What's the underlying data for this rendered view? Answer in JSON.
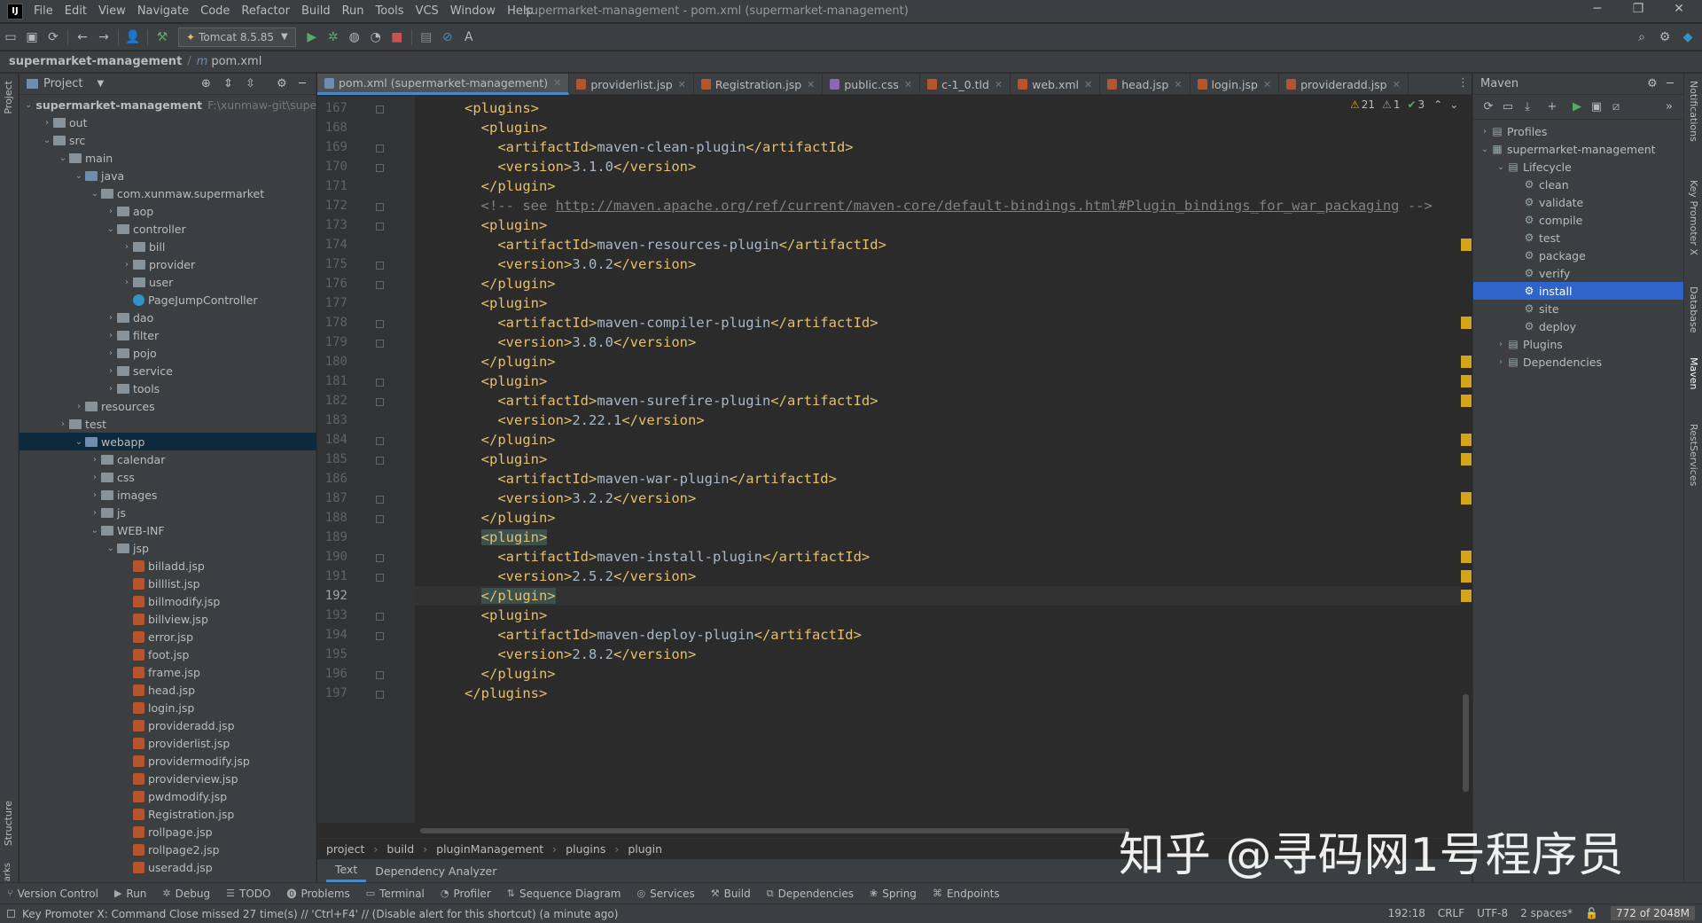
{
  "menu": [
    "File",
    "Edit",
    "View",
    "Navigate",
    "Code",
    "Refactor",
    "Build",
    "Run",
    "Tools",
    "VCS",
    "Window",
    "Help"
  ],
  "window_title": "supermarket-management - pom.xml (supermarket-management)",
  "run_config": "Tomcat 8.5.85",
  "breadcrumb": {
    "project": "supermarket-management",
    "file": "pom.xml"
  },
  "left_stripe": {
    "project": "Project",
    "structure": "Structure",
    "bookmarks": "Bookmarks"
  },
  "right_stripe": {
    "notifications": "Notifications",
    "key_promoter": "Key Promoter X",
    "database": "Database",
    "maven": "Maven",
    "rest": "RestServices"
  },
  "project_panel": {
    "title": "Project"
  },
  "tree": [
    {
      "label": "supermarket-management",
      "hint": "F:\\xunmaw-git\\superr",
      "depth": 0,
      "arrow": "open",
      "icon": "folder-module",
      "bold": true
    },
    {
      "label": "out",
      "depth": 1,
      "arrow": "closed",
      "icon": "folder"
    },
    {
      "label": "src",
      "depth": 1,
      "arrow": "open",
      "icon": "folder"
    },
    {
      "label": "main",
      "depth": 2,
      "arrow": "open",
      "icon": "folder"
    },
    {
      "label": "java",
      "depth": 3,
      "arrow": "open",
      "icon": "folder-blue"
    },
    {
      "label": "com.xunmaw.supermarket",
      "depth": 4,
      "arrow": "open",
      "icon": "folder"
    },
    {
      "label": "aop",
      "depth": 5,
      "arrow": "closed",
      "icon": "folder"
    },
    {
      "label": "controller",
      "depth": 5,
      "arrow": "open",
      "icon": "folder"
    },
    {
      "label": "bill",
      "depth": 6,
      "arrow": "closed",
      "icon": "folder"
    },
    {
      "label": "provider",
      "depth": 6,
      "arrow": "closed",
      "icon": "folder"
    },
    {
      "label": "user",
      "depth": 6,
      "arrow": "closed",
      "icon": "folder"
    },
    {
      "label": "PageJumpController",
      "depth": 6,
      "arrow": "none",
      "icon": "class"
    },
    {
      "label": "dao",
      "depth": 5,
      "arrow": "closed",
      "icon": "folder"
    },
    {
      "label": "filter",
      "depth": 5,
      "arrow": "closed",
      "icon": "folder"
    },
    {
      "label": "pojo",
      "depth": 5,
      "arrow": "closed",
      "icon": "folder"
    },
    {
      "label": "service",
      "depth": 5,
      "arrow": "closed",
      "icon": "folder"
    },
    {
      "label": "tools",
      "depth": 5,
      "arrow": "closed",
      "icon": "folder"
    },
    {
      "label": "resources",
      "depth": 3,
      "arrow": "closed",
      "icon": "folder"
    },
    {
      "label": "test",
      "depth": 2,
      "arrow": "closed",
      "icon": "folder"
    },
    {
      "label": "webapp",
      "depth": 3,
      "arrow": "open",
      "icon": "folder-blue",
      "selected": true
    },
    {
      "label": "calendar",
      "depth": 4,
      "arrow": "closed",
      "icon": "folder"
    },
    {
      "label": "css",
      "depth": 4,
      "arrow": "closed",
      "icon": "folder"
    },
    {
      "label": "images",
      "depth": 4,
      "arrow": "closed",
      "icon": "folder"
    },
    {
      "label": "js",
      "depth": 4,
      "arrow": "closed",
      "icon": "folder"
    },
    {
      "label": "WEB-INF",
      "depth": 4,
      "arrow": "open",
      "icon": "folder"
    },
    {
      "label": "jsp",
      "depth": 5,
      "arrow": "open",
      "icon": "folder"
    },
    {
      "label": "billadd.jsp",
      "depth": 6,
      "arrow": "none",
      "icon": "jsp"
    },
    {
      "label": "billlist.jsp",
      "depth": 6,
      "arrow": "none",
      "icon": "jsp"
    },
    {
      "label": "billmodify.jsp",
      "depth": 6,
      "arrow": "none",
      "icon": "jsp"
    },
    {
      "label": "billview.jsp",
      "depth": 6,
      "arrow": "none",
      "icon": "jsp"
    },
    {
      "label": "error.jsp",
      "depth": 6,
      "arrow": "none",
      "icon": "jsp"
    },
    {
      "label": "foot.jsp",
      "depth": 6,
      "arrow": "none",
      "icon": "jsp"
    },
    {
      "label": "frame.jsp",
      "depth": 6,
      "arrow": "none",
      "icon": "jsp"
    },
    {
      "label": "head.jsp",
      "depth": 6,
      "arrow": "none",
      "icon": "jsp"
    },
    {
      "label": "login.jsp",
      "depth": 6,
      "arrow": "none",
      "icon": "jsp"
    },
    {
      "label": "provideradd.jsp",
      "depth": 6,
      "arrow": "none",
      "icon": "jsp"
    },
    {
      "label": "providerlist.jsp",
      "depth": 6,
      "arrow": "none",
      "icon": "jsp"
    },
    {
      "label": "providermodify.jsp",
      "depth": 6,
      "arrow": "none",
      "icon": "jsp"
    },
    {
      "label": "providerview.jsp",
      "depth": 6,
      "arrow": "none",
      "icon": "jsp"
    },
    {
      "label": "pwdmodify.jsp",
      "depth": 6,
      "arrow": "none",
      "icon": "jsp"
    },
    {
      "label": "Registration.jsp",
      "depth": 6,
      "arrow": "none",
      "icon": "jsp"
    },
    {
      "label": "rollpage.jsp",
      "depth": 6,
      "arrow": "none",
      "icon": "jsp"
    },
    {
      "label": "rollpage2.jsp",
      "depth": 6,
      "arrow": "none",
      "icon": "jsp"
    },
    {
      "label": "useradd.jsp",
      "depth": 6,
      "arrow": "none",
      "icon": "jsp"
    }
  ],
  "tabs": [
    {
      "label": "pom.xml (supermarket-management)",
      "active": true,
      "color": "#6e8cb0"
    },
    {
      "label": "providerlist.jsp",
      "color": "#b5552d"
    },
    {
      "label": "Registration.jsp",
      "color": "#b5552d"
    },
    {
      "label": "public.css",
      "color": "#8d68b0"
    },
    {
      "label": "c-1_0.tld",
      "color": "#b5552d"
    },
    {
      "label": "web.xml",
      "color": "#b5552d"
    },
    {
      "label": "head.jsp",
      "color": "#b5552d"
    },
    {
      "label": "login.jsp",
      "color": "#b5552d"
    },
    {
      "label": "provideradd.jsp",
      "color": "#b5552d"
    }
  ],
  "inspections": {
    "warnings": "21",
    "weak": "1",
    "ok": "3"
  },
  "code": [
    {
      "n": "167",
      "indent": 4,
      "parts": [
        {
          "t": "tag",
          "s": "<plugins>"
        }
      ]
    },
    {
      "n": "168",
      "indent": 6,
      "parts": [
        {
          "t": "tag",
          "s": "<plugin>"
        }
      ]
    },
    {
      "n": "169",
      "indent": 8,
      "parts": [
        {
          "t": "tag",
          "s": "<artifactId>"
        },
        {
          "t": "txt",
          "s": "maven-clean-plugin"
        },
        {
          "t": "tag",
          "s": "</artifactId>"
        }
      ]
    },
    {
      "n": "170",
      "indent": 8,
      "parts": [
        {
          "t": "tag",
          "s": "<version>"
        },
        {
          "t": "txt",
          "s": "3.1.0"
        },
        {
          "t": "tag",
          "s": "</version>"
        }
      ]
    },
    {
      "n": "171",
      "indent": 6,
      "parts": [
        {
          "t": "tag",
          "s": "</plugin>"
        }
      ]
    },
    {
      "n": "172",
      "indent": 6,
      "parts": [
        {
          "t": "cmt",
          "s": "<!-- see "
        },
        {
          "t": "url",
          "s": "http://maven.apache.org/ref/current/maven-core/default-bindings.html#Plugin_bindings_for_war_packaging"
        },
        {
          "t": "cmt",
          "s": " -->"
        }
      ]
    },
    {
      "n": "173",
      "indent": 6,
      "parts": [
        {
          "t": "tag",
          "s": "<plugin>"
        }
      ]
    },
    {
      "n": "174",
      "indent": 8,
      "parts": [
        {
          "t": "tag",
          "s": "<artifactId>"
        },
        {
          "t": "txt",
          "s": "maven-resources-plugin"
        },
        {
          "t": "tag",
          "s": "</artifactId>"
        }
      ]
    },
    {
      "n": "175",
      "indent": 8,
      "parts": [
        {
          "t": "tag",
          "s": "<version>"
        },
        {
          "t": "txt",
          "s": "3.0.2"
        },
        {
          "t": "tag",
          "s": "</version>"
        }
      ]
    },
    {
      "n": "176",
      "indent": 6,
      "parts": [
        {
          "t": "tag",
          "s": "</plugin>"
        }
      ]
    },
    {
      "n": "177",
      "indent": 6,
      "parts": [
        {
          "t": "tag",
          "s": "<plugin>"
        }
      ]
    },
    {
      "n": "178",
      "indent": 8,
      "parts": [
        {
          "t": "tag",
          "s": "<artifactId>"
        },
        {
          "t": "txt",
          "s": "maven-compiler-plugin"
        },
        {
          "t": "tag",
          "s": "</artifactId>"
        }
      ]
    },
    {
      "n": "179",
      "indent": 8,
      "parts": [
        {
          "t": "tag",
          "s": "<version>"
        },
        {
          "t": "txt",
          "s": "3.8.0"
        },
        {
          "t": "tag",
          "s": "</version>"
        }
      ]
    },
    {
      "n": "180",
      "indent": 6,
      "parts": [
        {
          "t": "tag",
          "s": "</plugin>"
        }
      ]
    },
    {
      "n": "181",
      "indent": 6,
      "parts": [
        {
          "t": "tag",
          "s": "<plugin>"
        }
      ]
    },
    {
      "n": "182",
      "indent": 8,
      "parts": [
        {
          "t": "tag",
          "s": "<artifactId>"
        },
        {
          "t": "txt",
          "s": "maven-surefire-plugin"
        },
        {
          "t": "tag",
          "s": "</artifactId>"
        }
      ]
    },
    {
      "n": "183",
      "indent": 8,
      "parts": [
        {
          "t": "tag",
          "s": "<version>"
        },
        {
          "t": "txt",
          "s": "2.22.1"
        },
        {
          "t": "tag",
          "s": "</version>"
        }
      ]
    },
    {
      "n": "184",
      "indent": 6,
      "parts": [
        {
          "t": "tag",
          "s": "</plugin>"
        }
      ]
    },
    {
      "n": "185",
      "indent": 6,
      "parts": [
        {
          "t": "tag",
          "s": "<plugin>"
        }
      ]
    },
    {
      "n": "186",
      "indent": 8,
      "parts": [
        {
          "t": "tag",
          "s": "<artifactId>"
        },
        {
          "t": "txt",
          "s": "maven-war-plugin"
        },
        {
          "t": "tag",
          "s": "</artifactId>"
        }
      ]
    },
    {
      "n": "187",
      "indent": 8,
      "parts": [
        {
          "t": "tag",
          "s": "<version>"
        },
        {
          "t": "txt",
          "s": "3.2.2"
        },
        {
          "t": "tag",
          "s": "</version>"
        }
      ]
    },
    {
      "n": "188",
      "indent": 6,
      "parts": [
        {
          "t": "tag",
          "s": "</plugin>"
        }
      ]
    },
    {
      "n": "189",
      "indent": 6,
      "parts": [
        {
          "t": "tag-hl",
          "s": "<plugin>"
        }
      ]
    },
    {
      "n": "190",
      "indent": 8,
      "parts": [
        {
          "t": "tag",
          "s": "<artifactId>"
        },
        {
          "t": "txt",
          "s": "maven-install-plugin"
        },
        {
          "t": "tag",
          "s": "</artifactId>"
        }
      ]
    },
    {
      "n": "191",
      "indent": 8,
      "parts": [
        {
          "t": "tag",
          "s": "<version>"
        },
        {
          "t": "txt",
          "s": "2.5.2"
        },
        {
          "t": "tag",
          "s": "</version>"
        }
      ]
    },
    {
      "n": "192",
      "indent": 6,
      "parts": [
        {
          "t": "tag-hl",
          "s": "</plugin>"
        }
      ],
      "current": true
    },
    {
      "n": "193",
      "indent": 6,
      "parts": [
        {
          "t": "tag",
          "s": "<plugin>"
        }
      ]
    },
    {
      "n": "194",
      "indent": 8,
      "parts": [
        {
          "t": "tag",
          "s": "<artifactId>"
        },
        {
          "t": "txt",
          "s": "maven-deploy-plugin"
        },
        {
          "t": "tag",
          "s": "</artifactId>"
        }
      ]
    },
    {
      "n": "195",
      "indent": 8,
      "parts": [
        {
          "t": "tag",
          "s": "<version>"
        },
        {
          "t": "txt",
          "s": "2.8.2"
        },
        {
          "t": "tag",
          "s": "</version>"
        }
      ]
    },
    {
      "n": "196",
      "indent": 6,
      "parts": [
        {
          "t": "tag",
          "s": "</plugin>"
        }
      ]
    },
    {
      "n": "197",
      "indent": 4,
      "parts": [
        {
          "t": "tag",
          "s": "</plugins>"
        }
      ]
    }
  ],
  "code_breadcrumb": [
    "project",
    "build",
    "pluginManagement",
    "plugins",
    "plugin"
  ],
  "editor_bottom_tabs": [
    {
      "label": "Text",
      "active": true
    },
    {
      "label": "Dependency Analyzer"
    }
  ],
  "maven": {
    "title": "Maven",
    "nodes": [
      {
        "label": "Profiles",
        "depth": 0,
        "arrow": "closed",
        "icon": "profiles"
      },
      {
        "label": "supermarket-management",
        "depth": 0,
        "arrow": "open",
        "icon": "module"
      },
      {
        "label": "Lifecycle",
        "depth": 1,
        "arrow": "open",
        "icon": "folder"
      },
      {
        "label": "clean",
        "depth": 2,
        "arrow": "none",
        "icon": "gear"
      },
      {
        "label": "validate",
        "depth": 2,
        "arrow": "none",
        "icon": "gear"
      },
      {
        "label": "compile",
        "depth": 2,
        "arrow": "none",
        "icon": "gear"
      },
      {
        "label": "test",
        "depth": 2,
        "arrow": "none",
        "icon": "gear"
      },
      {
        "label": "package",
        "depth": 2,
        "arrow": "none",
        "icon": "gear"
      },
      {
        "label": "verify",
        "depth": 2,
        "arrow": "none",
        "icon": "gear"
      },
      {
        "label": "install",
        "depth": 2,
        "arrow": "none",
        "icon": "gear",
        "selected": true
      },
      {
        "label": "site",
        "depth": 2,
        "arrow": "none",
        "icon": "gear"
      },
      {
        "label": "deploy",
        "depth": 2,
        "arrow": "none",
        "icon": "gear"
      },
      {
        "label": "Plugins",
        "depth": 1,
        "arrow": "closed",
        "icon": "folder"
      },
      {
        "label": "Dependencies",
        "depth": 1,
        "arrow": "closed",
        "icon": "folder"
      }
    ]
  },
  "tool_windows": [
    "Version Control",
    "Run",
    "Debug",
    "TODO",
    "Problems",
    "Terminal",
    "Profiler",
    "Sequence Diagram",
    "Services",
    "Build",
    "Dependencies",
    "Spring",
    "Endpoints"
  ],
  "status": {
    "message": "Key Promoter X: Command Close missed 27 time(s) // 'Ctrl+F4' // (Disable alert for this shortcut) (a minute ago)",
    "position": "192:18",
    "line_sep": "CRLF",
    "encoding": "UTF-8",
    "indent": "2 spaces*",
    "memory": "772 of 2048M"
  },
  "watermark": "知乎 @寻码网1号程序员",
  "colors": {
    "accent": "#4a88c7",
    "tag": "#e8bf6a",
    "selection": "#2f65ca",
    "warning": "#d4a51a"
  }
}
